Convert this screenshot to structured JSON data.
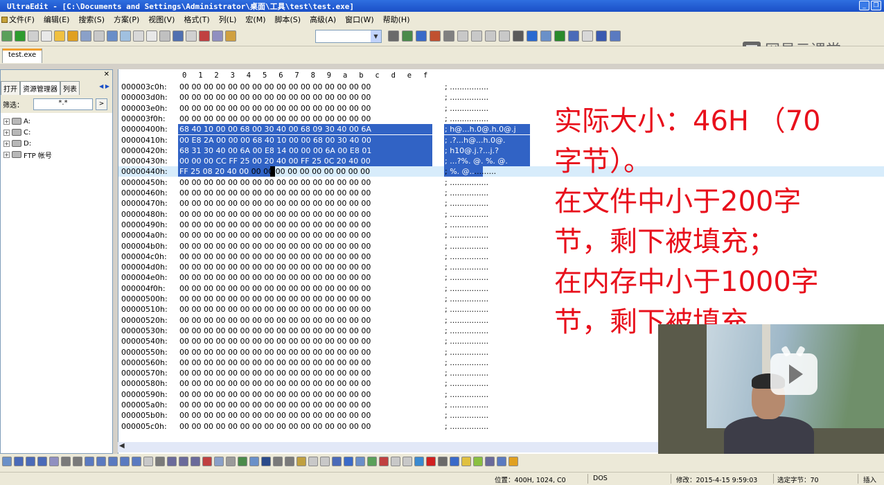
{
  "window": {
    "title": "UltraEdit - [C:\\Documents and Settings\\Administrator\\桌面\\工具\\test\\test.exe]"
  },
  "menu": [
    "文件(F)",
    "编辑(E)",
    "搜索(S)",
    "方案(P)",
    "视图(V)",
    "格式(T)",
    "列(L)",
    "宏(M)",
    "脚本(S)",
    "高级(A)",
    "窗口(W)",
    "帮助(H)"
  ],
  "watermark": "网易云课堂",
  "file_tab": "test.exe",
  "left_panel": {
    "tabs": [
      "打开",
      "资源管理器",
      "列表"
    ],
    "filter_label": "筛选：",
    "filter_value": "*.*",
    "tree": [
      "A:",
      "C:",
      "D:",
      "FTP 帐号"
    ]
  },
  "hex": {
    "header": [
      "0",
      "1",
      "2",
      "3",
      "4",
      "5",
      "6",
      "7",
      "8",
      "9",
      "a",
      "b",
      "c",
      "d",
      "e",
      "f"
    ],
    "rows": [
      {
        "addr": "000003c0h:",
        "bytes": "00 00 00 00 00 00 00 00 00 00 00 00 00 00 00 00",
        "ascii": "; ................"
      },
      {
        "addr": "000003d0h:",
        "bytes": "00 00 00 00 00 00 00 00 00 00 00 00 00 00 00 00",
        "ascii": "; ................"
      },
      {
        "addr": "000003e0h:",
        "bytes": "00 00 00 00 00 00 00 00 00 00 00 00 00 00 00 00",
        "ascii": "; ................"
      },
      {
        "addr": "000003f0h:",
        "bytes": "00 00 00 00 00 00 00 00 00 00 00 00 00 00 00 00",
        "ascii": "; ................"
      },
      {
        "addr": "00000400h:",
        "bytes": "68 40 10 00 00 68 00 30 40 00 68 09 30 40 00 6A",
        "ascii": "; h@...h.0@.h.0@.j"
      },
      {
        "addr": "00000410h:",
        "bytes": "00 E8 2A 00 00 00 68 40 10 00 00 68 00 30 40 00",
        "ascii": "; .?...h@...h.0@."
      },
      {
        "addr": "00000420h:",
        "bytes": "68 31 30 40 00 6A 00 E8 14 00 00 00 6A 00 E8 01",
        "ascii": "; h10@.j.?...j.?"
      },
      {
        "addr": "00000430h:",
        "bytes": "00 00 00 CC FF 25 00 20 40 00 FF 25 0C 20 40 00",
        "ascii": "; ...?%. @.  %. @."
      },
      {
        "addr": "00000440h:",
        "bytes": "FF 25 08 20 40 00 00 00 00 00 00 00 00 00 00 00",
        "ascii": ";  %. @..........."
      },
      {
        "addr": "00000450h:",
        "bytes": "00 00 00 00 00 00 00 00 00 00 00 00 00 00 00 00",
        "ascii": "; ................"
      },
      {
        "addr": "00000460h:",
        "bytes": "00 00 00 00 00 00 00 00 00 00 00 00 00 00 00 00",
        "ascii": "; ................"
      },
      {
        "addr": "00000470h:",
        "bytes": "00 00 00 00 00 00 00 00 00 00 00 00 00 00 00 00",
        "ascii": "; ................"
      },
      {
        "addr": "00000480h:",
        "bytes": "00 00 00 00 00 00 00 00 00 00 00 00 00 00 00 00",
        "ascii": "; ................"
      },
      {
        "addr": "00000490h:",
        "bytes": "00 00 00 00 00 00 00 00 00 00 00 00 00 00 00 00",
        "ascii": "; ................"
      },
      {
        "addr": "000004a0h:",
        "bytes": "00 00 00 00 00 00 00 00 00 00 00 00 00 00 00 00",
        "ascii": "; ................"
      },
      {
        "addr": "000004b0h:",
        "bytes": "00 00 00 00 00 00 00 00 00 00 00 00 00 00 00 00",
        "ascii": "; ................"
      },
      {
        "addr": "000004c0h:",
        "bytes": "00 00 00 00 00 00 00 00 00 00 00 00 00 00 00 00",
        "ascii": "; ................"
      },
      {
        "addr": "000004d0h:",
        "bytes": "00 00 00 00 00 00 00 00 00 00 00 00 00 00 00 00",
        "ascii": "; ................"
      },
      {
        "addr": "000004e0h:",
        "bytes": "00 00 00 00 00 00 00 00 00 00 00 00 00 00 00 00",
        "ascii": "; ................"
      },
      {
        "addr": "000004f0h:",
        "bytes": "00 00 00 00 00 00 00 00 00 00 00 00 00 00 00 00",
        "ascii": "; ................"
      },
      {
        "addr": "00000500h:",
        "bytes": "00 00 00 00 00 00 00 00 00 00 00 00 00 00 00 00",
        "ascii": "; ................"
      },
      {
        "addr": "00000510h:",
        "bytes": "00 00 00 00 00 00 00 00 00 00 00 00 00 00 00 00",
        "ascii": "; ................"
      },
      {
        "addr": "00000520h:",
        "bytes": "00 00 00 00 00 00 00 00 00 00 00 00 00 00 00 00",
        "ascii": "; ................"
      },
      {
        "addr": "00000530h:",
        "bytes": "00 00 00 00 00 00 00 00 00 00 00 00 00 00 00 00",
        "ascii": "; ................"
      },
      {
        "addr": "00000540h:",
        "bytes": "00 00 00 00 00 00 00 00 00 00 00 00 00 00 00 00",
        "ascii": "; ................"
      },
      {
        "addr": "00000550h:",
        "bytes": "00 00 00 00 00 00 00 00 00 00 00 00 00 00 00 00",
        "ascii": "; ................"
      },
      {
        "addr": "00000560h:",
        "bytes": "00 00 00 00 00 00 00 00 00 00 00 00 00 00 00 00",
        "ascii": "; ................"
      },
      {
        "addr": "00000570h:",
        "bytes": "00 00 00 00 00 00 00 00 00 00 00 00 00 00 00 00",
        "ascii": "; ................"
      },
      {
        "addr": "00000580h:",
        "bytes": "00 00 00 00 00 00 00 00 00 00 00 00 00 00 00 00",
        "ascii": "; ................"
      },
      {
        "addr": "00000590h:",
        "bytes": "00 00 00 00 00 00 00 00 00 00 00 00 00 00 00 00",
        "ascii": "; ................"
      },
      {
        "addr": "000005a0h:",
        "bytes": "00 00 00 00 00 00 00 00 00 00 00 00 00 00 00 00",
        "ascii": "; ................"
      },
      {
        "addr": "000005b0h:",
        "bytes": "00 00 00 00 00 00 00 00 00 00 00 00 00 00 00 00",
        "ascii": "; ................"
      },
      {
        "addr": "000005c0h:",
        "bytes": "00 00 00 00 00 00 00 00 00 00 00 00 00 00 00 00",
        "ascii": "; ................"
      }
    ]
  },
  "annotation": [
    "实际大小：46H （70",
    "字节）。",
    "在文件中小于200字",
    "节，剩下被填充；",
    "在内存中小于1000字",
    "节，剩下被填充"
  ],
  "status": {
    "position": "位置：400H, 1024, C0",
    "format": "DOS",
    "modified": "修改：2015-4-15 9:59:03",
    "selected": "选定字节：70",
    "mode": "插入"
  },
  "colors": {
    "selection": "#3163c5",
    "current_line": "#d7ecfb",
    "annotation": "#e8101c",
    "titlebar": "#1a4fc7"
  }
}
